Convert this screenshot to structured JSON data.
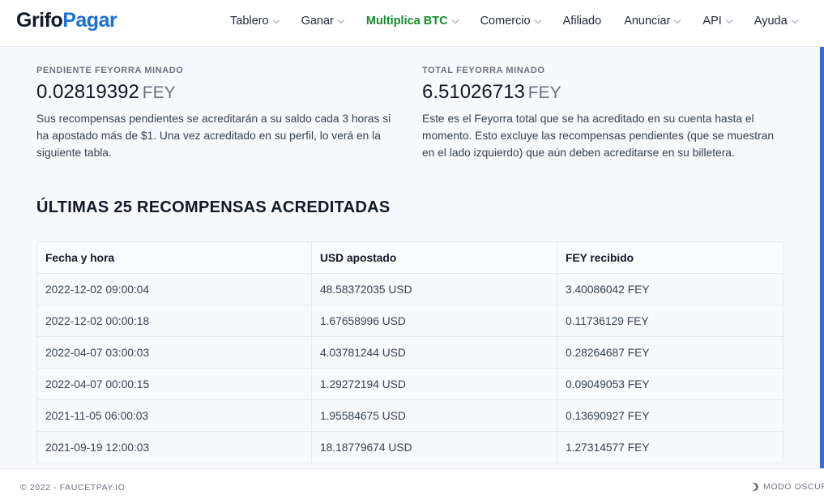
{
  "brand": {
    "part1": "Grifo",
    "part2": "Pagar",
    "color": "#1c6fd8"
  },
  "nav": [
    {
      "label": "Tablero",
      "dropdown": true,
      "active": false
    },
    {
      "label": "Ganar",
      "dropdown": true,
      "active": false
    },
    {
      "label": "Multiplica BTC",
      "dropdown": true,
      "active": true
    },
    {
      "label": "Comercio",
      "dropdown": true,
      "active": false
    },
    {
      "label": "Afiliado",
      "dropdown": false,
      "active": false
    },
    {
      "label": "Anunciar",
      "dropdown": true,
      "active": false
    },
    {
      "label": "API",
      "dropdown": true,
      "active": false
    },
    {
      "label": "Ayuda",
      "dropdown": true,
      "active": false
    }
  ],
  "pending": {
    "label": "PENDIENTE FEYORRA MINADO",
    "amount": "0.02819392",
    "unit": "FEY",
    "description": "Sus recompensas pendientes se acreditarán a su saldo cada 3 horas si ha apostado más de $1. Una vez acreditado en su perfil, lo verá en la siguiente tabla."
  },
  "total": {
    "label": "TOTAL FEYORRA MINADO",
    "amount": "6.51026713",
    "unit": "FEY",
    "description": "Este es el Feyorra total que se ha acreditado en su cuenta hasta el momento. Esto excluye las recompensas pendientes (que se muestran en el lado izquierdo) que aún deben acreditarse en su billetera."
  },
  "rewards": {
    "title": "ÚLTIMAS 25 RECOMPENSAS ACREDITADAS",
    "headers": [
      "Fecha y hora",
      "USD apostado",
      "FEY recibido"
    ],
    "rows": [
      [
        "2022-12-02 09:00:04",
        "48.58372035 USD",
        "3.40086042 FEY"
      ],
      [
        "2022-12-02 00:00:18",
        "1.67658996 USD",
        "0.11736129 FEY"
      ],
      [
        "2022-04-07 03:00:03",
        "4.03781244 USD",
        "0.28264687 FEY"
      ],
      [
        "2022-04-07 00:00:15",
        "1.29272194 USD",
        "0.09049053 FEY"
      ],
      [
        "2021-11-05 06:00:03",
        "1.95584675 USD",
        "0.13690927 FEY"
      ],
      [
        "2021-09-19 12:00:03",
        "18.18779674 USD",
        "1.27314577 FEY"
      ]
    ]
  },
  "footer": {
    "copyright": "© 2022 - FAUCETPAY.IO",
    "dark_mode": "MODO OSCURO"
  },
  "colors": {
    "active_nav": "#148c2e",
    "accent": "#2f6fe0"
  }
}
